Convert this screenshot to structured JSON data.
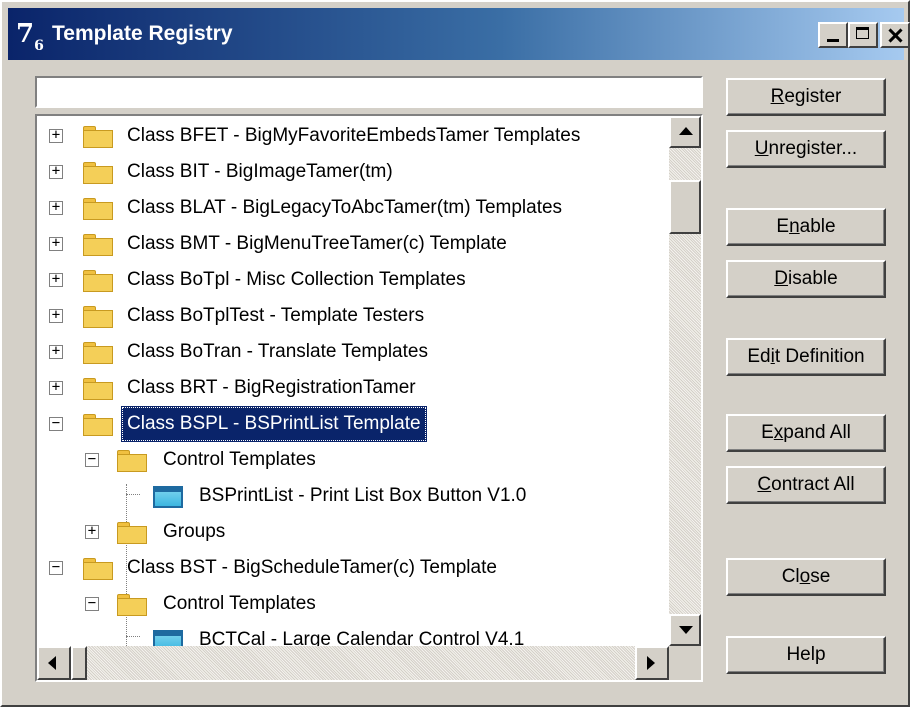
{
  "window": {
    "title": "Template Registry",
    "icon_glyph": "7",
    "icon_sub": "6",
    "icons": [
      "template-registry-app-icon",
      "minimize-icon",
      "maximize-icon",
      "close-icon"
    ]
  },
  "filter": {
    "value": "",
    "placeholder": ""
  },
  "tree": {
    "rows": [
      {
        "label": "Class BFET - BigMyFavoriteEmbedsTamer Templates",
        "expander": "+",
        "icon": "folder-icon"
      },
      {
        "label": "Class BIT - BigImageTamer(tm)",
        "expander": "+",
        "icon": "folder-icon"
      },
      {
        "label": "Class BLAT - BigLegacyToAbcTamer(tm) Templates",
        "expander": "+",
        "icon": "folder-icon"
      },
      {
        "label": "Class BMT - BigMenuTreeTamer(c) Template",
        "expander": "+",
        "icon": "folder-icon"
      },
      {
        "label": "Class BoTpl - Misc Collection Templates",
        "expander": "+",
        "icon": "folder-icon"
      },
      {
        "label": "Class BoTplTest - Template Testers",
        "expander": "+",
        "icon": "folder-icon"
      },
      {
        "label": "Class BoTran -  Translate Templates",
        "expander": "+",
        "icon": "folder-icon"
      },
      {
        "label": "Class BRT - BigRegistrationTamer",
        "expander": "+",
        "icon": "folder-icon"
      },
      {
        "label": "Class BSPL - BSPrintList Template",
        "expander": "−",
        "icon": "folder-icon",
        "selected": true
      },
      {
        "label": "Control Templates",
        "expander": "−",
        "icon": "folder-icon"
      },
      {
        "label": "BSPrintList - Print List Box Button V1.0",
        "icon": "control-template-icon"
      },
      {
        "label": "Groups",
        "expander": "+",
        "icon": "folder-icon"
      },
      {
        "label": "Class BST - BigScheduleTamer(c) Template",
        "expander": "−",
        "icon": "folder-icon"
      },
      {
        "label": "Control Templates",
        "expander": "−",
        "icon": "folder-icon"
      },
      {
        "label": "BCTCal - Large Calendar Control V4.1",
        "icon": "control-template-icon"
      }
    ]
  },
  "buttons": {
    "register": {
      "pre": "",
      "u": "R",
      "post": "egister"
    },
    "unregister": {
      "pre": "",
      "u": "U",
      "post": "nregister..."
    },
    "enable": {
      "pre": "E",
      "u": "n",
      "post": "able"
    },
    "disable": {
      "pre": "",
      "u": "D",
      "post": "isable"
    },
    "edit_definition": {
      "pre": "Ed",
      "u": "i",
      "post": "t Definition"
    },
    "expand_all": {
      "pre": "E",
      "u": "x",
      "post": "pand All"
    },
    "contract_all": {
      "pre": "",
      "u": "C",
      "post": "ontract All"
    },
    "close": {
      "pre": "Cl",
      "u": "o",
      "post": "se"
    },
    "help": {
      "pre": "Help",
      "u": "",
      "post": ""
    }
  },
  "colors": {
    "title_active": "#0a246a",
    "selection": "#0a246a",
    "face": "#d4d0c8",
    "folder": "#f4cf58"
  }
}
